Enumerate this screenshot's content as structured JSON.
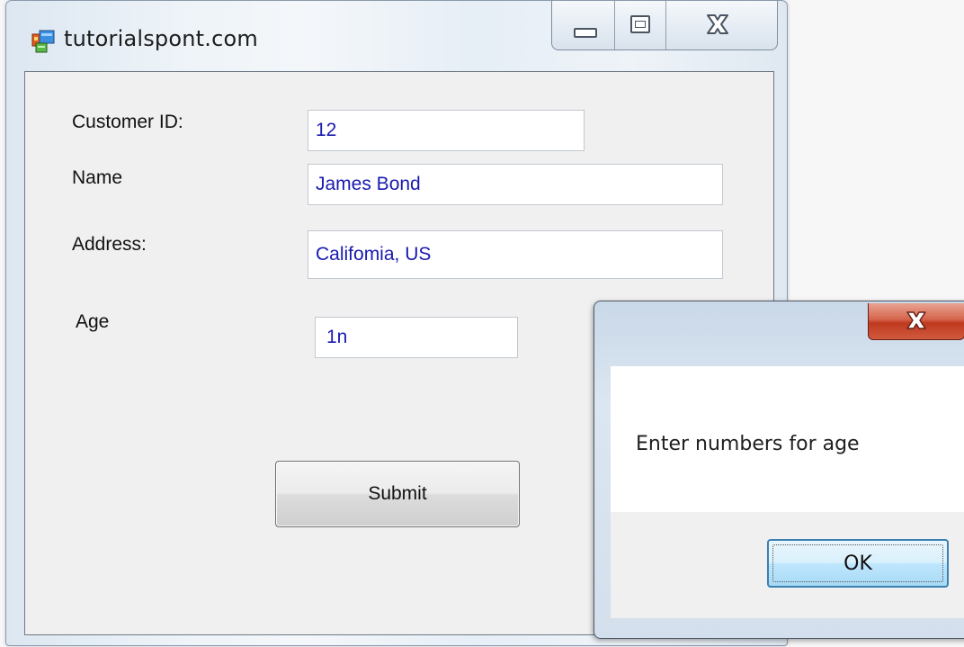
{
  "window": {
    "title": "tutorialspont.com",
    "icon": "winforms-app-icon"
  },
  "form": {
    "customer_id": {
      "label": "Customer ID:",
      "value": "12"
    },
    "name": {
      "label": "Name",
      "value": "James Bond"
    },
    "address": {
      "label": "Address:",
      "value": "Califomia, US"
    },
    "age": {
      "label": "Age",
      "value": "1n"
    },
    "submit_label": "Submit"
  },
  "message_box": {
    "message": "Enter numbers for age",
    "ok_label": "OK"
  },
  "colors": {
    "input_text": "#1a1ab0",
    "close_button": "#c0391e",
    "ok_button_border": "#3c7fb1"
  }
}
